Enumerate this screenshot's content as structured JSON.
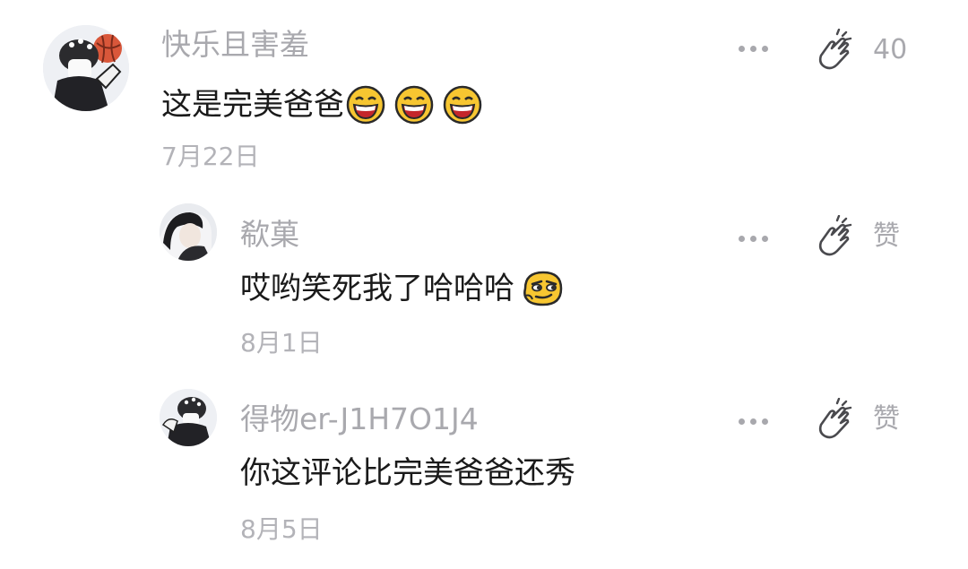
{
  "comments": [
    {
      "username": "快乐且害羞",
      "text": "这是完美爸爸",
      "date": "7月22日",
      "like_label": "40",
      "emojis": [
        "grin-emoji",
        "grin-emoji",
        "grin-emoji"
      ]
    },
    {
      "username": "欷菓",
      "text": "哎哟笑死我了哈哈哈",
      "date": "8月1日",
      "like_label": "赞",
      "emojis": [
        "smirk-emoji"
      ]
    },
    {
      "username": "得物er-J1H7O1J4",
      "text": "你这评论比完美爸爸还秀",
      "date": "8月5日",
      "like_label": "赞",
      "emojis": []
    }
  ],
  "colors": {
    "username": "#a9a9ae",
    "text": "#1a1a1a",
    "meta": "#b3b3b8",
    "emoji_face": "#f7c631"
  },
  "icons": {
    "more": "more-dots-icon",
    "like": "hand-like-icon"
  }
}
